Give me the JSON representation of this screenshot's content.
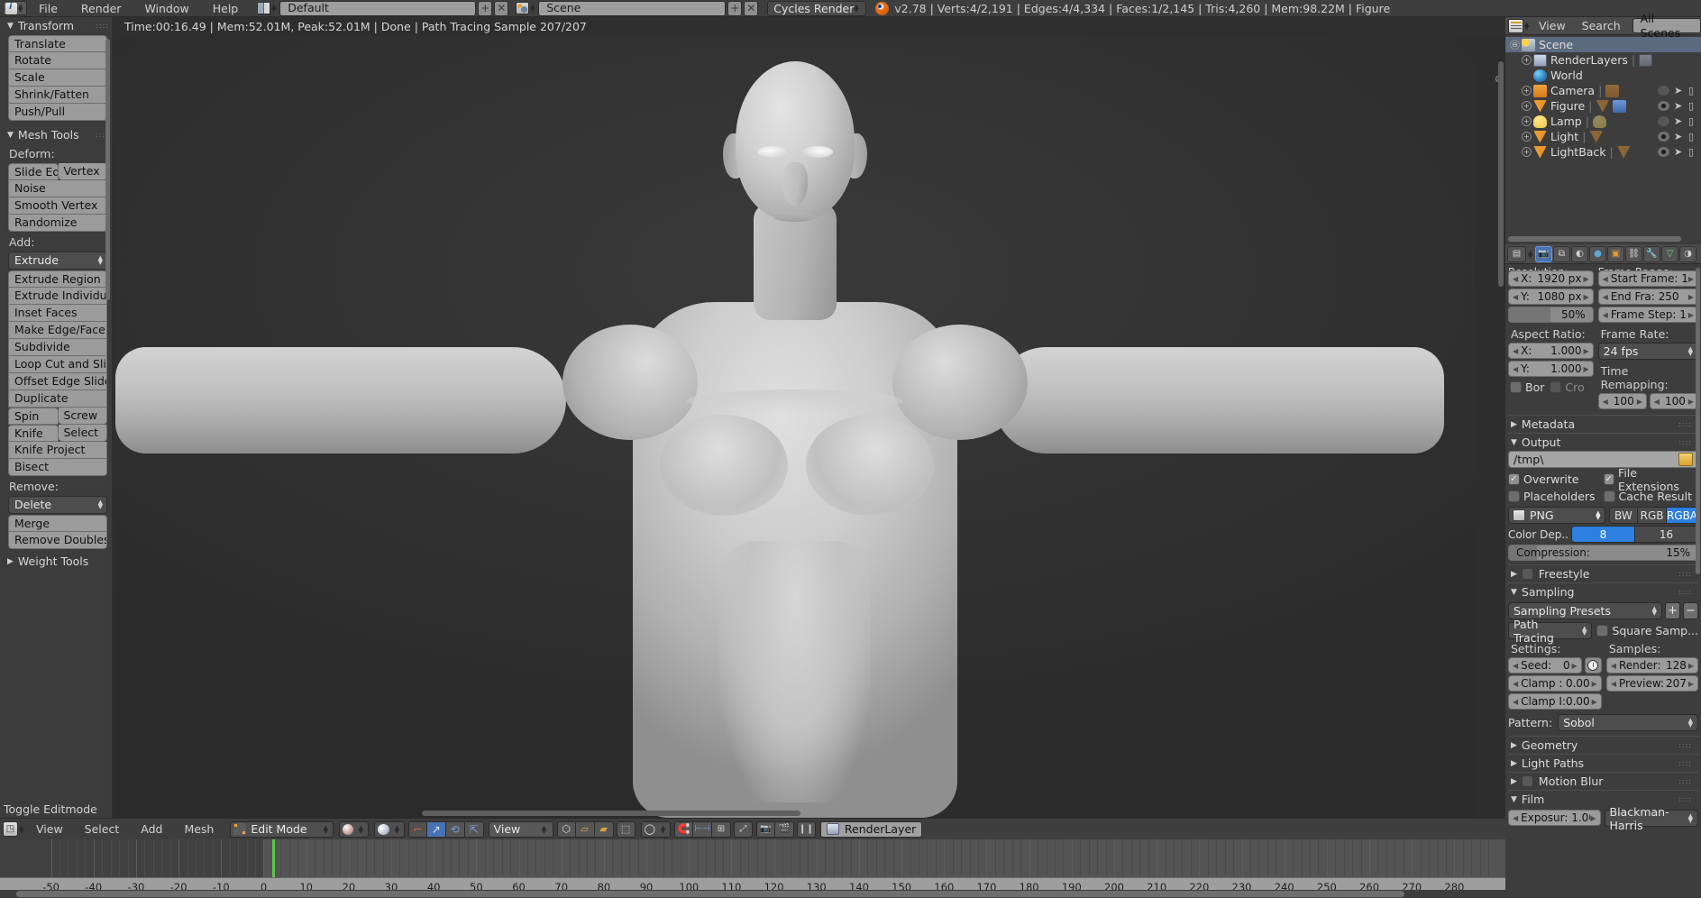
{
  "app": {
    "title": "Blender",
    "version_stats": "v2.78 | Verts:4/2,191 | Edges:4/4,334 | Faces:1/2,145 | Tris:4,260 | Mem:98.22M | Figure"
  },
  "topbar": {
    "menus": [
      "File",
      "Render",
      "Window",
      "Help"
    ],
    "screen_layout": "Default",
    "scene_name": "Scene",
    "render_engine": "Cycles Render",
    "add_label": "+",
    "remove_label": "✕",
    "icons": {
      "info_editor": "info-editor-icon",
      "screen_layout": "screen-layout-icon",
      "scene_data": "scene-data-icon",
      "blender_logo": "blender-logo-icon"
    }
  },
  "toolshelf": {
    "panels": [
      {
        "title": "Transform",
        "open": true,
        "buttons": [
          "Translate",
          "Rotate",
          "Scale",
          "Shrink/Fatten",
          "Push/Pull"
        ]
      },
      {
        "title": "Mesh Tools",
        "open": true,
        "deform_label": "Deform:",
        "deform_row": [
          "Slide Ed",
          "Vertex"
        ],
        "deform_buttons": [
          "Noise",
          "Smooth Vertex",
          "Randomize"
        ],
        "add_label": "Add:",
        "add_dropdown": "Extrude",
        "add_buttons": [
          "Extrude Region",
          "Extrude Individual",
          "Inset Faces",
          "Make Edge/Face",
          "Subdivide",
          "Loop Cut and Slide",
          "Offset Edge Slide",
          "Duplicate"
        ],
        "add_rows": [
          [
            "Spin",
            "Screw"
          ],
          [
            "Knife",
            "Select"
          ]
        ],
        "add_buttons2": [
          "Knife Project",
          "Bisect"
        ],
        "remove_label": "Remove:",
        "remove_dropdown": "Delete",
        "remove_buttons": [
          "Merge",
          "Remove Doubles"
        ]
      },
      {
        "title": "Weight Tools",
        "open": false
      }
    ],
    "toggle_editmode": "Toggle Editmode"
  },
  "viewport": {
    "render_info": "Time:00:16.49 | Mem:52.01M, Peak:52.01M | Done | Path Tracing Sample 207/207",
    "subject": "human-figure-render"
  },
  "vpheader": {
    "menus": [
      "View",
      "Select",
      "Add",
      "Mesh"
    ],
    "mode": "Edit Mode",
    "view_dropdown": "View",
    "render_layer": "RenderLayer",
    "icons": {
      "editor_type": "editor-type-icon",
      "mode_icon": "edit-mode-icon",
      "shading": "viewport-shading-icon",
      "pivot": "pivot-point-icon",
      "manipulator_translate": "translate-manipulator-icon",
      "manipulator_rotate": "rotate-manipulator-icon",
      "manipulator_scale": "scale-manipulator-icon",
      "vertex_select": "vertex-select-mode-icon",
      "edge_select": "edge-select-mode-icon",
      "face_select": "face-select-mode-icon",
      "occlude": "limit-selection-visible-icon",
      "proportional": "proportional-editing-icon",
      "snap": "snap-magnet-icon",
      "snap_target": "snap-target-icon",
      "render_btn": "render-image-icon",
      "render_anim": "render-animation-icon",
      "pause": "pause-icon",
      "renderlayer_icon": "renderlayer-icon"
    }
  },
  "timeline": {
    "current_frame": 2,
    "labels": [
      -50,
      -40,
      -30,
      -20,
      -10,
      0,
      10,
      20,
      30,
      40,
      50,
      60,
      70,
      80,
      90,
      100,
      110,
      120,
      130,
      140,
      150,
      160,
      170,
      180,
      190,
      200,
      210,
      220,
      230,
      240,
      250,
      260,
      270,
      280
    ],
    "playhead_color": "#5ec44a"
  },
  "outliner": {
    "header": {
      "view": "View",
      "search": "Search",
      "display_mode": "All Scenes"
    },
    "rows": [
      {
        "label": "Scene",
        "icon": "scene-icon",
        "indent": 0,
        "selected": true,
        "expander": "⊖",
        "vis": null
      },
      {
        "label": "RenderLayers",
        "icon": "renderlayer-icon",
        "indent": 1,
        "selected": false,
        "expander": "+",
        "extra": "renderlayer-data-icon",
        "vis": null
      },
      {
        "label": "World",
        "icon": "world-icon",
        "indent": 1,
        "selected": false,
        "expander": "",
        "vis": null
      },
      {
        "label": "Camera",
        "icon": "camera-icon",
        "indent": 1,
        "selected": false,
        "expander": "+",
        "extra": "camera-data-icon",
        "vis": "off"
      },
      {
        "label": "Figure",
        "icon": "mesh-icon",
        "indent": 1,
        "selected": false,
        "expander": "+",
        "extra": "mesh-data-icon",
        "extra2": "modifier-wrench-icon",
        "vis": "on"
      },
      {
        "label": "Lamp",
        "icon": "lamp-icon",
        "indent": 1,
        "selected": false,
        "expander": "+",
        "extra": "lamp-data-icon",
        "vis": "off"
      },
      {
        "label": "Light",
        "icon": "mesh-icon",
        "indent": 1,
        "selected": false,
        "expander": "+",
        "extra": "mesh-data-icon",
        "vis": "on"
      },
      {
        "label": "LightBack",
        "icon": "mesh-icon",
        "indent": 1,
        "selected": false,
        "expander": "+",
        "extra": "mesh-data-icon",
        "vis": "on"
      }
    ]
  },
  "properties": {
    "tabs": [
      {
        "name": "render-tab",
        "glyph": "📷",
        "active": true
      },
      {
        "name": "render-layers-tab",
        "glyph": "⧉",
        "active": false
      },
      {
        "name": "scene-tab",
        "glyph": "◐",
        "active": false
      },
      {
        "name": "world-tab",
        "glyph": "●",
        "active": false
      },
      {
        "name": "object-tab",
        "glyph": "▣",
        "active": false
      },
      {
        "name": "constraints-tab",
        "glyph": "⚭",
        "active": false
      },
      {
        "name": "modifiers-tab",
        "glyph": "🔧",
        "active": false
      },
      {
        "name": "data-tab",
        "glyph": "▽",
        "active": false
      },
      {
        "name": "material-tab",
        "glyph": "◑",
        "active": false
      }
    ],
    "dimensions": {
      "resolution_label": "Resolution:",
      "res_x_label": "X:",
      "res_x": "1920 px",
      "res_y_label": "Y:",
      "res_y": "1080 px",
      "res_percent": "50%",
      "aspect_label": "Aspect Ratio:",
      "aspect_x_label": "X:",
      "aspect_x": "1.000",
      "aspect_y_label": "Y:",
      "aspect_y": "1.000",
      "border": "Bor",
      "crop": "Cro",
      "frame_range_label": "Frame Range:",
      "start_frame": "Start Frame: 1",
      "end_frame": "End Fra:  250",
      "frame_step": "Frame Step: 1",
      "frame_rate_label": "Frame Rate:",
      "frame_rate": "24 fps",
      "time_remap_label": "Time Remapping:",
      "remap_old": "100",
      "remap_new": "100"
    },
    "metadata": {
      "title": "Metadata",
      "open": false
    },
    "output": {
      "title": "Output",
      "open": true,
      "path": "/tmp\\",
      "overwrite": "Overwrite",
      "overwrite_on": true,
      "file_extensions": "File Extensions",
      "file_extensions_on": true,
      "placeholders": "Placeholders",
      "placeholders_on": false,
      "cache_result": "Cache Result",
      "cache_result_on": false,
      "format": "PNG",
      "color_modes": [
        "BW",
        "RGB",
        "RGBA"
      ],
      "color_mode_selected": "RGBA",
      "color_depth_label": "Color Dep...",
      "color_depths": [
        "8",
        "16"
      ],
      "color_depth_selected": "8",
      "compression_label": "Compression:",
      "compression_value": "15%"
    },
    "freestyle": {
      "title": "Freestyle",
      "open": false,
      "enabled": false
    },
    "sampling": {
      "title": "Sampling",
      "open": true,
      "presets": "Sampling Presets",
      "integrator": "Path Tracing",
      "square_samples": "Square Samp...",
      "square_samples_on": false,
      "settings_label": "Settings:",
      "seed_label": "Seed:",
      "seed": "0",
      "clamp_direct_label": "Clamp :",
      "clamp_direct": "0.00",
      "clamp_indirect_label": "Clamp I:",
      "clamp_indirect": "0.00",
      "samples_label": "Samples:",
      "render_label": "Render:",
      "render_samples": "128",
      "preview_label": "Preview:",
      "preview_samples": "207",
      "pattern_label": "Pattern:",
      "pattern": "Sobol"
    },
    "geometry": {
      "title": "Geometry",
      "open": false
    },
    "light_paths": {
      "title": "Light Paths",
      "open": false
    },
    "motion_blur": {
      "title": "Motion Blur",
      "open": false,
      "enabled": false
    },
    "film": {
      "title": "Film",
      "open": true,
      "exposure_label": "Exposur: 1.00",
      "filter": "Blackman-Harris"
    }
  }
}
